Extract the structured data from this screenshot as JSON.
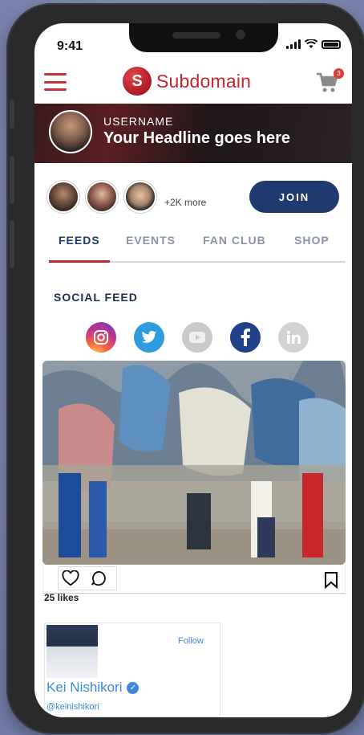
{
  "status": {
    "time": "9:41",
    "cart_count": "3"
  },
  "header": {
    "brand_initial": "S",
    "brand_name": "Subdomain"
  },
  "banner": {
    "username": "USERNAME",
    "headline": "Your Headline goes here"
  },
  "members": {
    "more_label": "+2K more",
    "join_label": "JOIN"
  },
  "tabs": [
    {
      "label": "FEEDS",
      "active": true
    },
    {
      "label": "EVENTS",
      "active": false
    },
    {
      "label": "FAN CLUB",
      "active": false
    },
    {
      "label": "SHOP",
      "active": false
    }
  ],
  "feed": {
    "section_title": "SOCIAL FEED",
    "socials": [
      "instagram-icon",
      "twitter-icon",
      "youtube-icon",
      "facebook-icon",
      "linkedin-icon"
    ],
    "likes": "25 likes"
  },
  "profile_card": {
    "follow_label": "Follow",
    "name": "Kei Nishikori",
    "handle": "@keinishikori"
  },
  "colors": {
    "accent": "#c8242c",
    "primary": "#1e3a6e",
    "link": "#3b8ad9"
  }
}
